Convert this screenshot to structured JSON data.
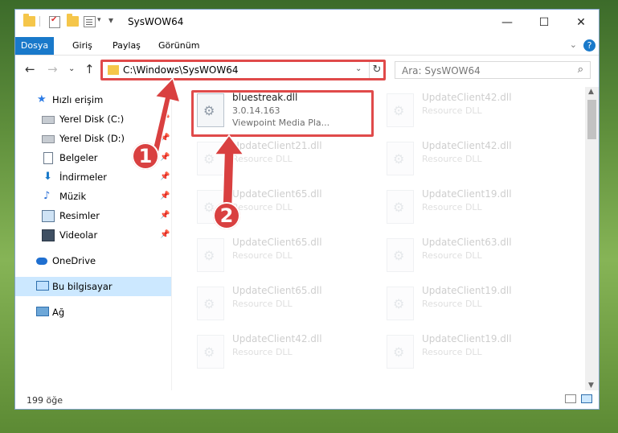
{
  "window": {
    "title": "SysWOW64",
    "minimize": "—",
    "maximize": "☐",
    "close": "✕"
  },
  "ribbon": {
    "tabs": [
      "Dosya",
      "Giriş",
      "Paylaş",
      "Görünüm"
    ],
    "collapse": "⌄",
    "help": "?"
  },
  "nav": {
    "back": "←",
    "forward": "→",
    "recent": "⌄",
    "up": "↑",
    "address": "C:\\Windows\\SysWOW64",
    "address_dropdown": "⌄",
    "refresh": "↻",
    "search_placeholder": "Ara: SysWOW64",
    "search_icon": "⌕"
  },
  "sidebar": {
    "items": [
      {
        "label": "Hızlı erişim",
        "icon": "star-icon",
        "pinned": false
      },
      {
        "label": "Yerel Disk (C:)",
        "icon": "drive-icon",
        "pinned": true
      },
      {
        "label": "Yerel Disk (D:)",
        "icon": "drive-icon",
        "pinned": true
      },
      {
        "label": "Belgeler",
        "icon": "documents-icon",
        "pinned": true
      },
      {
        "label": "İndirmeler",
        "icon": "download-icon",
        "pinned": true
      },
      {
        "label": "Müzik",
        "icon": "music-icon",
        "pinned": true
      },
      {
        "label": "Resimler",
        "icon": "pictures-icon",
        "pinned": true
      },
      {
        "label": "Videolar",
        "icon": "videos-icon",
        "pinned": true
      },
      {
        "label": "OneDrive",
        "icon": "cloud-icon",
        "pinned": false
      },
      {
        "label": "Bu bilgisayar",
        "icon": "computer-icon",
        "pinned": false,
        "selected": true
      },
      {
        "label": "Ağ",
        "icon": "network-icon",
        "pinned": false
      }
    ],
    "pin_glyph": "📌"
  },
  "files": {
    "highlighted": {
      "name": "bluestreak.dll",
      "version": "3.0.14.163",
      "description": "Viewpoint Media Pla..."
    },
    "left": [
      {
        "name": "UpdateClient21.dll",
        "type": "Resource DLL"
      },
      {
        "name": "UpdateClient65.dll",
        "type": "Resource DLL"
      },
      {
        "name": "UpdateClient65.dll",
        "type": "Resource DLL"
      },
      {
        "name": "UpdateClient65.dll",
        "type": "Resource DLL"
      },
      {
        "name": "UpdateClient42.dll",
        "type": "Resource DLL"
      }
    ],
    "right": [
      {
        "name": "UpdateClient42.dll",
        "type": "Resource DLL"
      },
      {
        "name": "UpdateClient42.dll",
        "type": "Resource DLL"
      },
      {
        "name": "UpdateClient19.dll",
        "type": "Resource DLL"
      },
      {
        "name": "UpdateClient63.dll",
        "type": "Resource DLL"
      },
      {
        "name": "UpdateClient19.dll",
        "type": "Resource DLL"
      },
      {
        "name": "UpdateClient19.dll",
        "type": "Resource DLL"
      }
    ]
  },
  "status": {
    "item_count": "199 öğe"
  },
  "annotations": {
    "step1": "1",
    "step2": "2",
    "color": "#d94040"
  }
}
